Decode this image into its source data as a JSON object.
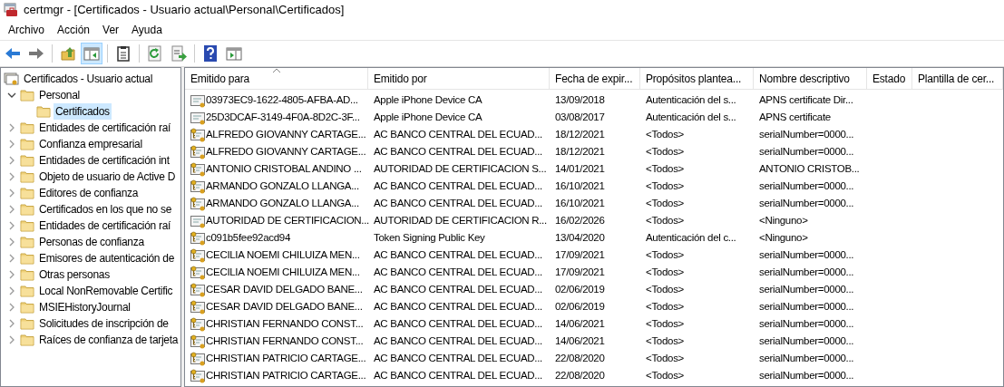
{
  "window": {
    "title": "certmgr - [Certificados - Usuario actual\\Personal\\Certificados]"
  },
  "menu": [
    "Archivo",
    "Acción",
    "Ver",
    "Ayuda"
  ],
  "toolbar": [
    {
      "kind": "back",
      "pressed": false
    },
    {
      "kind": "forward",
      "pressed": false
    },
    {
      "kind": "sep"
    },
    {
      "kind": "up",
      "pressed": false
    },
    {
      "kind": "tree",
      "pressed": true
    },
    {
      "kind": "sep"
    },
    {
      "kind": "clipboard",
      "pressed": false
    },
    {
      "kind": "sep"
    },
    {
      "kind": "refresh",
      "pressed": false
    },
    {
      "kind": "export",
      "pressed": false
    },
    {
      "kind": "sep"
    },
    {
      "kind": "help",
      "pressed": false
    },
    {
      "kind": "pane",
      "pressed": false
    }
  ],
  "tree": {
    "label": "Certificados - Usuario actual",
    "selected": false,
    "children": [
      {
        "label": "Personal",
        "expanded": true,
        "selected": false,
        "children": [
          {
            "label": "Certificados",
            "selected": true
          }
        ]
      },
      {
        "label": "Entidades de certificación raí",
        "expanded": false,
        "selected": false
      },
      {
        "label": "Confianza empresarial",
        "expanded": false,
        "selected": false
      },
      {
        "label": "Entidades de certificación int",
        "expanded": false,
        "selected": false
      },
      {
        "label": "Objeto de usuario de Active D",
        "expanded": false,
        "selected": false
      },
      {
        "label": "Editores de confianza",
        "expanded": false,
        "selected": false
      },
      {
        "label": "Certificados en los que no se",
        "expanded": false,
        "selected": false
      },
      {
        "label": "Entidades de certificación raí",
        "expanded": false,
        "selected": false
      },
      {
        "label": "Personas de confianza",
        "expanded": false,
        "selected": false
      },
      {
        "label": "Emisores de autenticación de",
        "expanded": false,
        "selected": false
      },
      {
        "label": "Otras personas",
        "expanded": false,
        "selected": false
      },
      {
        "label": "Local NonRemovable Certific",
        "expanded": false,
        "selected": false
      },
      {
        "label": "MSIEHistoryJournal",
        "expanded": false,
        "selected": false
      },
      {
        "label": "Solicitudes de inscripción de",
        "expanded": false,
        "selected": false
      },
      {
        "label": "Raíces de confianza de tarjeta",
        "expanded": false,
        "selected": false
      }
    ]
  },
  "table": {
    "columns": [
      "Emitido para",
      "Emitido por",
      "Fecha de expir...",
      "Propósitos plantea...",
      "Nombre descriptivo",
      "Estado",
      "Plantilla de cer..."
    ],
    "rows": [
      {
        "private_key": false,
        "cells": [
          "03973EC9-1622-4805-AFBA-AD...",
          "Apple iPhone Device CA",
          "13/09/2018",
          "Autenticación del s...",
          "APNS certificate Dir..."
        ]
      },
      {
        "private_key": false,
        "cells": [
          "25D3DCAF-3149-4F0A-8D2C-3F...",
          "Apple iPhone Device CA",
          "03/08/2017",
          "Autenticación del s...",
          "APNS certificate"
        ]
      },
      {
        "private_key": true,
        "cells": [
          "ALFREDO GIOVANNY CARTAGE...",
          "AC BANCO CENTRAL DEL ECUAD...",
          "18/12/2021",
          "<Todos>",
          "serialNumber=0000..."
        ]
      },
      {
        "private_key": true,
        "cells": [
          "ALFREDO GIOVANNY CARTAGE...",
          "AC BANCO CENTRAL DEL ECUAD...",
          "18/12/2021",
          "<Todos>",
          "serialNumber=0000..."
        ]
      },
      {
        "private_key": true,
        "cells": [
          "ANTONIO CRISTOBAL ANDINO ...",
          "AUTORIDAD DE CERTIFICACION S...",
          "14/01/2021",
          "<Todos>",
          "ANTONIO CRISTOB..."
        ]
      },
      {
        "private_key": true,
        "cells": [
          "ARMANDO GONZALO LLANGA...",
          "AC BANCO CENTRAL DEL ECUAD...",
          "16/10/2021",
          "<Todos>",
          "serialNumber=0000..."
        ]
      },
      {
        "private_key": true,
        "cells": [
          "ARMANDO GONZALO LLANGA...",
          "AC BANCO CENTRAL DEL ECUAD...",
          "16/10/2021",
          "<Todos>",
          "serialNumber=0000..."
        ]
      },
      {
        "private_key": false,
        "cells": [
          "AUTORIDAD DE CERTIFICACION...",
          "AUTORIDAD DE CERTIFICACION R...",
          "16/02/2026",
          "<Todos>",
          "<Ninguno>"
        ]
      },
      {
        "private_key": true,
        "cells": [
          "c091b5fee92acd94",
          "Token Signing Public Key",
          "13/04/2020",
          "Autenticación del c...",
          "<Ninguno>"
        ]
      },
      {
        "private_key": true,
        "cells": [
          "CECILIA NOEMI CHILUIZA MEN...",
          "AC BANCO CENTRAL DEL ECUAD...",
          "17/09/2021",
          "<Todos>",
          "serialNumber=0000..."
        ]
      },
      {
        "private_key": true,
        "cells": [
          "CECILIA NOEMI CHILUIZA MEN...",
          "AC BANCO CENTRAL DEL ECUAD...",
          "17/09/2021",
          "<Todos>",
          "serialNumber=0000..."
        ]
      },
      {
        "private_key": true,
        "cells": [
          "CESAR DAVID DELGADO BANE...",
          "AC BANCO CENTRAL DEL ECUAD...",
          "02/06/2019",
          "<Todos>",
          "serialNumber=0000..."
        ]
      },
      {
        "private_key": true,
        "cells": [
          "CESAR DAVID DELGADO BANE...",
          "AC BANCO CENTRAL DEL ECUAD...",
          "02/06/2019",
          "<Todos>",
          "serialNumber=0000..."
        ]
      },
      {
        "private_key": true,
        "cells": [
          "CHRISTIAN FERNANDO CONST...",
          "AC BANCO CENTRAL DEL ECUAD...",
          "14/06/2021",
          "<Todos>",
          "serialNumber=0000..."
        ]
      },
      {
        "private_key": true,
        "cells": [
          "CHRISTIAN FERNANDO CONST...",
          "AC BANCO CENTRAL DEL ECUAD...",
          "14/06/2021",
          "<Todos>",
          "serialNumber=0000..."
        ]
      },
      {
        "private_key": true,
        "cells": [
          "CHRISTIAN PATRICIO CARTAGE...",
          "AC BANCO CENTRAL DEL ECUAD...",
          "22/08/2020",
          "<Todos>",
          "serialNumber=0000..."
        ]
      },
      {
        "private_key": true,
        "cells": [
          "CHRISTIAN PATRICIO CARTAGE...",
          "AC BANCO CENTRAL DEL ECUAD...",
          "22/08/2020",
          "<Todos>",
          "serialNumber=0000..."
        ]
      }
    ]
  }
}
